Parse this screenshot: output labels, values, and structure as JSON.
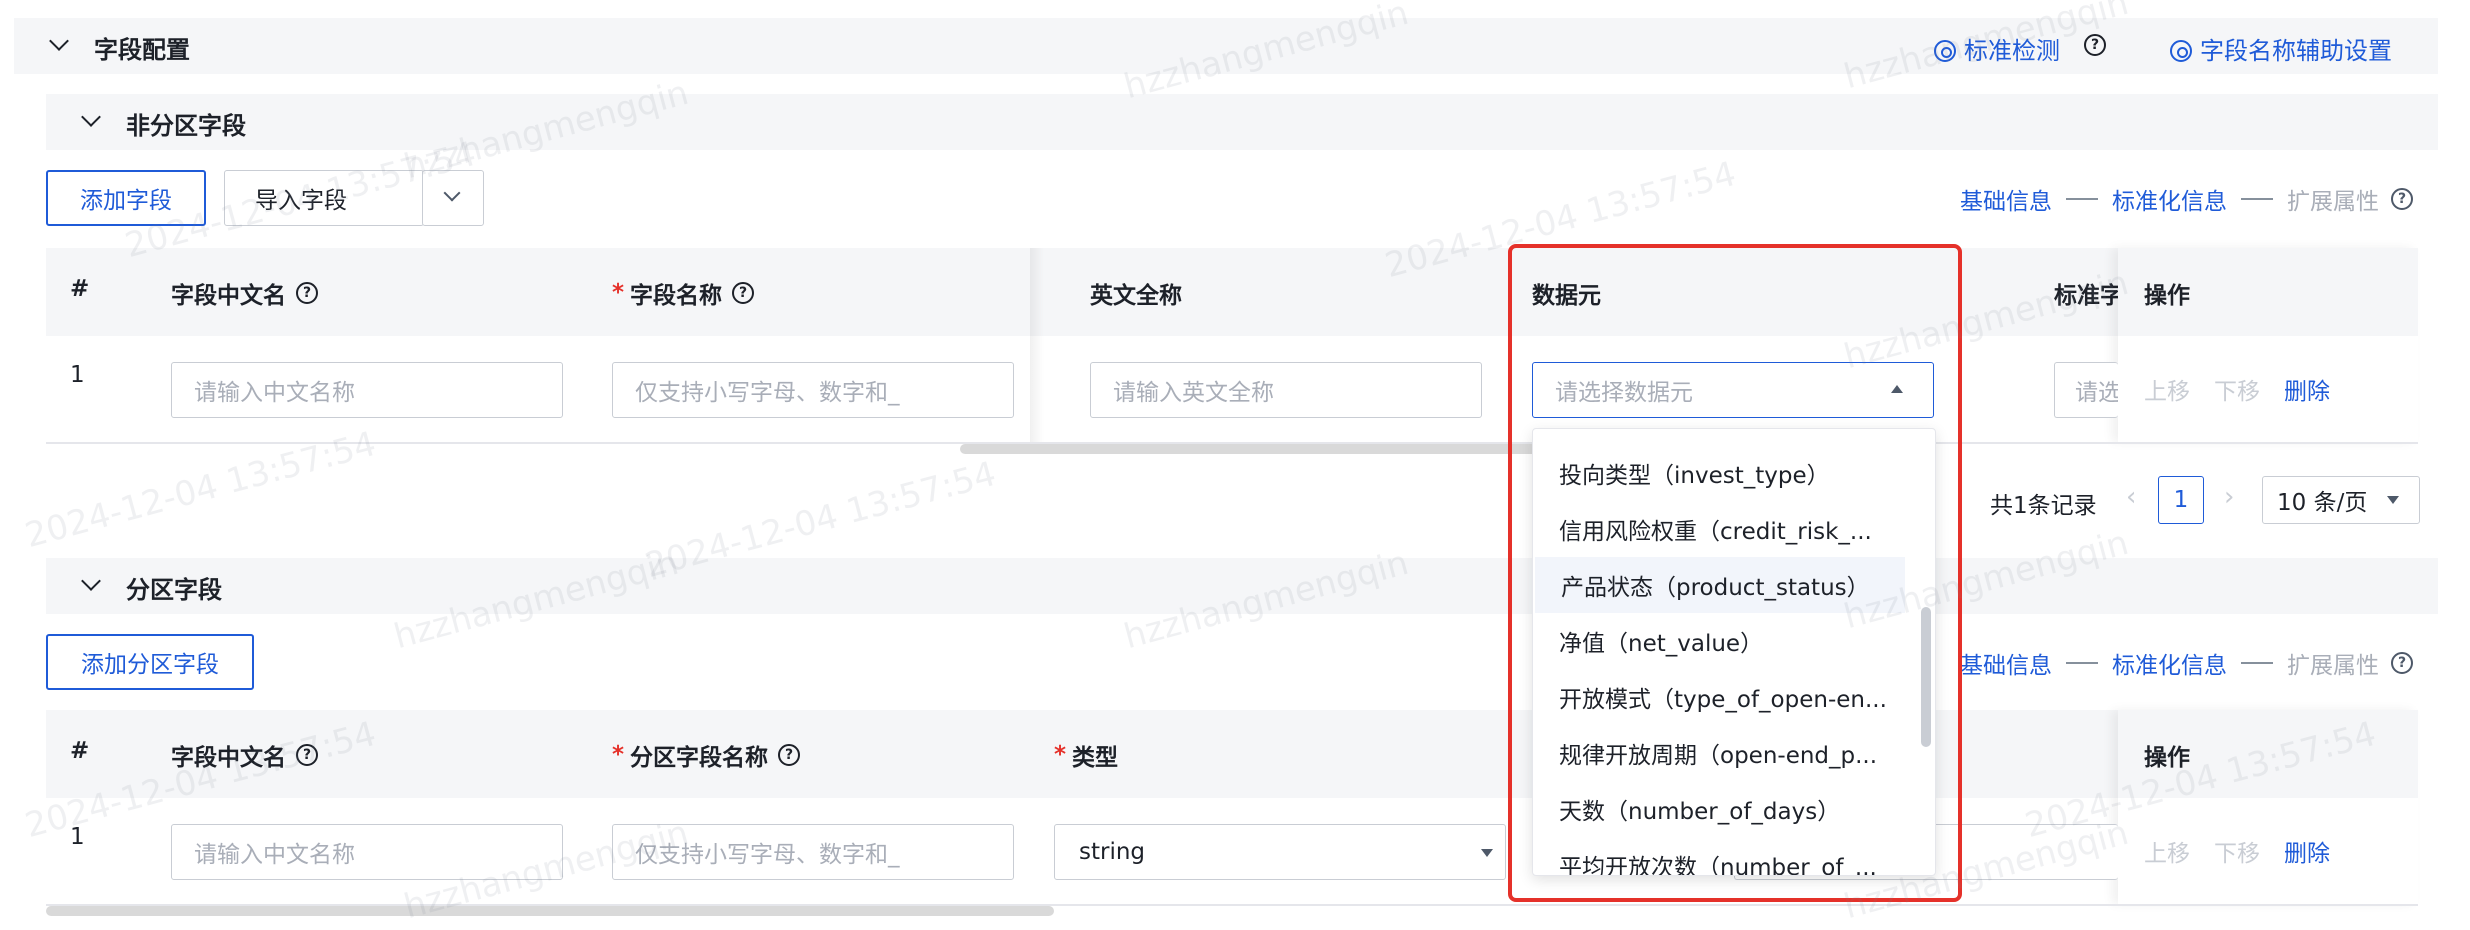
{
  "field_config": {
    "title": "字段配置",
    "standard_check": "标准检测",
    "name_assist": "字段名称辅助设置"
  },
  "non_partition": {
    "title": "非分区字段",
    "add_button": "添加字段",
    "import_button": "导入字段",
    "steps": {
      "basic": "基础信息",
      "standard": "标准化信息",
      "extend": "扩展属性"
    },
    "columns": {
      "index": "#",
      "cn_name": "字段中文名",
      "field_name": "字段名称",
      "en_full": "英文全称",
      "data_element": "数据元",
      "standard": "标准字",
      "ops": "操作"
    },
    "row": {
      "index": "1",
      "cn_placeholder": "请输入中文名称",
      "name_placeholder": "仅支持小写字母、数字和_",
      "en_placeholder": "请输入英文全称",
      "element_placeholder": "请选择数据元",
      "standard_placeholder": "请选",
      "op_up": "上移",
      "op_down": "下移",
      "op_delete": "删除"
    },
    "pager": {
      "total": "共1条记录",
      "page": "1",
      "size": "10 条/页"
    }
  },
  "partition": {
    "title": "分区字段",
    "add_button": "添加分区字段",
    "steps": {
      "basic": "基础信息",
      "standard": "标准化信息",
      "extend": "扩展属性"
    },
    "columns": {
      "index": "#",
      "cn_name": "字段中文名",
      "field_name": "分区字段名称",
      "type": "类型",
      "ops": "操作"
    },
    "row": {
      "index": "1",
      "cn_placeholder": "请输入中文名称",
      "name_placeholder": "仅支持小写字母、数字和_",
      "type_value": "string",
      "op_up": "上移",
      "op_down": "下移",
      "op_delete": "删除"
    }
  },
  "dropdown": {
    "items": [
      "投向类型（invest_type）",
      "信用风险权重（credit_risk_...",
      "产品状态（product_status）",
      "净值（net_value）",
      "开放模式（type_of_open-en...",
      "规律开放周期（open-end_p...",
      "天数（number_of_days）",
      "平均开放次数（number_of_..."
    ],
    "hover_index": 2
  },
  "watermark": {
    "user": "hzzhangmengqin",
    "timestamp": "2024-12-04 13:57:54"
  },
  "colors": {
    "primary": "#1f5bd8",
    "required": "#e5312a",
    "highlight_box": "#e5312a"
  }
}
